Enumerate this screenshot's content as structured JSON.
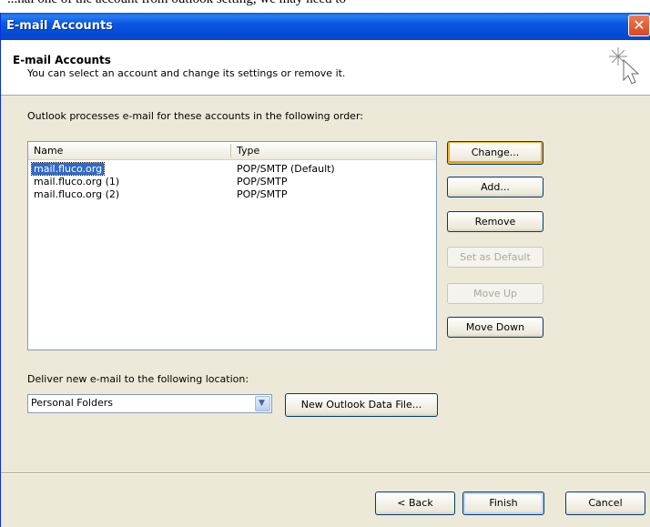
{
  "top_cut_text": "...nal one of the account from outlook setting, we may need to",
  "window": {
    "title": "E-mail Accounts",
    "close_glyph": "✕"
  },
  "header": {
    "title": "E-mail Accounts",
    "description": "You can select an account and change its settings or remove it."
  },
  "accounts_label": "Outlook processes e-mail for these accounts in the following order:",
  "accounts_list": {
    "columns": [
      "Name",
      "Type"
    ],
    "rows": [
      {
        "name": "mail.fluco.org",
        "type": "POP/SMTP (Default)",
        "selected": true
      },
      {
        "name": "mail.fluco.org (1)",
        "type": "POP/SMTP",
        "selected": false
      },
      {
        "name": "mail.fluco.org (2)",
        "type": "POP/SMTP",
        "selected": false
      }
    ]
  },
  "side_buttons": {
    "change": "Change...",
    "add": "Add...",
    "remove": "Remove",
    "set_default": "Set as Default",
    "move_up": "Move Up",
    "move_down": "Move Down"
  },
  "deliver": {
    "label": "Deliver new e-mail to the following location:",
    "value": "Personal Folders",
    "new_file_button": "New Outlook Data File..."
  },
  "footer": {
    "back": "< Back",
    "finish": "Finish",
    "cancel": "Cancel"
  },
  "colors": {
    "titlebar": "#0a58df",
    "face": "#ece9d8",
    "selection": "#316ac5",
    "button_border": "#003c74"
  },
  "icons": {
    "header": "cursor-sparkle-icon",
    "dropdown": "chevron-down-icon",
    "close": "close-icon"
  }
}
